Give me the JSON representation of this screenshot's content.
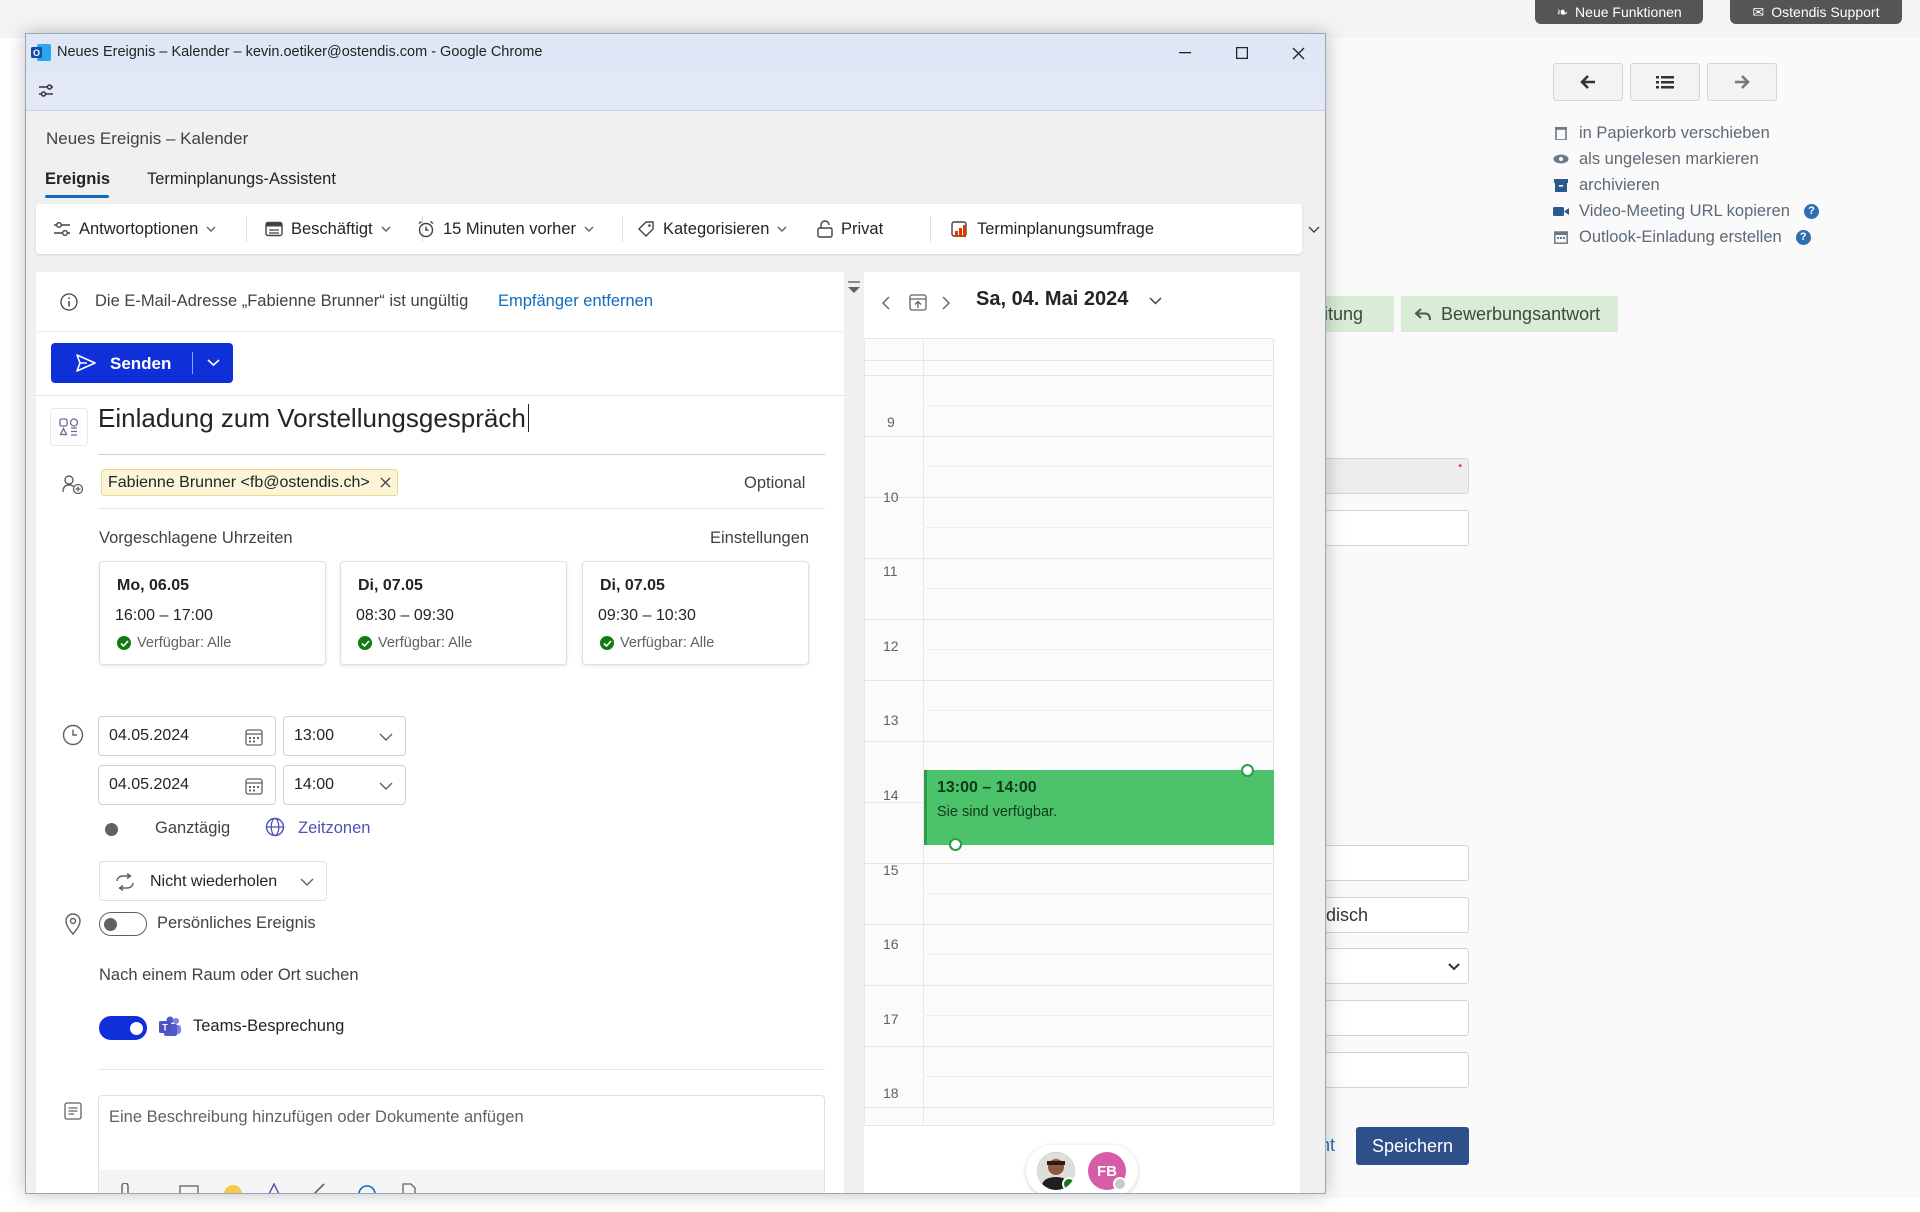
{
  "background": {
    "top_buttons": [
      "Neue Funktionen",
      "Ostendis Support"
    ],
    "actions": [
      {
        "label": "in Papierkorb verschieben",
        "icon": "trash-icon"
      },
      {
        "label": "als ungelesen markieren",
        "icon": "eye-icon"
      },
      {
        "label": "archivieren",
        "icon": "archive-icon"
      },
      {
        "label": "Video-Meeting URL kopieren",
        "icon": "video-icon"
      },
      {
        "label": "Outlook-Einladung erstellen",
        "icon": "calendar-icon"
      }
    ],
    "tags": [
      "eitung",
      "Bewerbungsantwort"
    ],
    "input_value": "ndisch",
    "link_fragment": "ht",
    "save_label": "Speichern"
  },
  "window": {
    "title": "Neues Ereignis – Kalender – kevin.oetiker@ostendis.com - Google Chrome"
  },
  "app": {
    "title": "Neues Ereignis – Kalender",
    "tabs": [
      "Ereignis",
      "Terminplanungs-Assistent"
    ],
    "ribbon": {
      "response": "Antwortoptionen",
      "busy": "Beschäftigt",
      "reminder": "15 Minuten vorher",
      "categorize": "Kategorisieren",
      "private": "Privat",
      "poll": "Terminplanungsumfrage"
    },
    "info": {
      "message": "Die E-Mail-Adresse „Fabienne Brunner“ ist ungültig",
      "action": "Empfänger entfernen"
    },
    "send_label": "Senden",
    "subject": "Einladung zum Vorstellungsgespräch",
    "attendee": "Fabienne Brunner <fb@ostendis.ch>",
    "optional_label": "Optional",
    "suggested_label": "Vorgeschlagene Uhrzeiten",
    "settings_label": "Einstellungen",
    "suggestions": [
      {
        "day": "Mo, 06.05",
        "time": "16:00 – 17:00",
        "availability": "Verfügbar: Alle"
      },
      {
        "day": "Di, 07.05",
        "time": "08:30 – 09:30",
        "availability": "Verfügbar: Alle"
      },
      {
        "day": "Di, 07.05",
        "time": "09:30 – 10:30",
        "availability": "Verfügbar: Alle"
      }
    ],
    "start_date": "04.05.2024",
    "start_time": "13:00",
    "end_date": "04.05.2024",
    "end_time": "14:00",
    "allday_label": "Ganztägig",
    "timezones_label": "Zeitzonen",
    "repeat_label": "Nicht wiederholen",
    "personal_label": "Persönliches Ereignis",
    "location_placeholder": "Nach einem Raum oder Ort suchen",
    "teams_label": "Teams-Besprechung",
    "teams_on": true,
    "allday_on": false,
    "personal_on": false,
    "description_placeholder": "Eine Beschreibung hinzufügen oder Dokumente anfügen"
  },
  "calendar": {
    "date": "Sa, 04. Mai 2024",
    "hours": [
      "9",
      "10",
      "11",
      "12",
      "13",
      "14",
      "15",
      "16",
      "17",
      "18"
    ],
    "event": {
      "time": "13:00 – 14:00",
      "status": "Sie sind verfügbar."
    },
    "attendee_initials": "FB"
  },
  "colors": {
    "accent": "#0f2fd8",
    "link": "#0f6cbd",
    "event": "#4cc26a",
    "available": "#107c10"
  }
}
